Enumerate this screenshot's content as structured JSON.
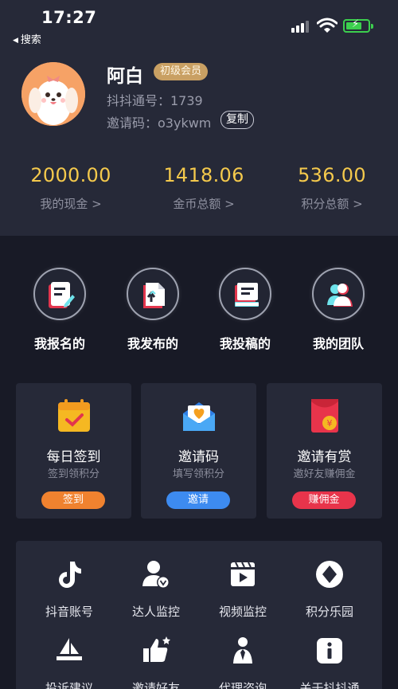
{
  "status_bar": {
    "time": "17:27",
    "back_label": "搜索"
  },
  "profile": {
    "name": "阿白",
    "badge": "初级会员",
    "uid_text": "抖抖通号：1739",
    "invite_text": "邀请码：o3ykwm",
    "copy_label": "复制"
  },
  "stats": [
    {
      "value": "2000.00",
      "label": "我的现金 >"
    },
    {
      "value": "1418.06",
      "label": "金币总额 >"
    },
    {
      "value": "536.00",
      "label": "积分总额 >"
    }
  ],
  "quick_nav": [
    {
      "label": "我报名的",
      "icon": "edit-form-icon"
    },
    {
      "label": "我发布的",
      "icon": "publish-file-icon"
    },
    {
      "label": "我投稿的",
      "icon": "submit-document-icon"
    },
    {
      "label": "我的团队",
      "icon": "team-icon"
    }
  ],
  "cards": [
    {
      "title": "每日签到",
      "subtitle": "签到领积分",
      "button": "签到",
      "button_color": "#f0822f",
      "icon": "calendar-check-icon"
    },
    {
      "title": "邀请码",
      "subtitle": "填写领积分",
      "button": "邀请",
      "button_color": "#3d8bf0",
      "icon": "envelope-heart-icon"
    },
    {
      "title": "邀请有赏",
      "subtitle": "邀好友赚佣金",
      "button": "赚佣金",
      "button_color": "#e8344b",
      "icon": "red-envelope-icon"
    }
  ],
  "services": [
    {
      "label": "抖音账号",
      "icon": "tiktok-icon"
    },
    {
      "label": "达人监控",
      "icon": "user-verified-icon"
    },
    {
      "label": "视频监控",
      "icon": "video-clapper-icon"
    },
    {
      "label": "积分乐园",
      "icon": "diamond-icon"
    },
    {
      "label": "投诉建议",
      "icon": "complaint-icon"
    },
    {
      "label": "邀请好友",
      "icon": "thumbs-up-icon"
    },
    {
      "label": "代理咨询",
      "icon": "agent-icon"
    },
    {
      "label": "关于抖抖通",
      "icon": "info-icon"
    }
  ],
  "colors": {
    "accent_gold": "#f4c94c",
    "background": "#181a26",
    "panel": "#262938"
  }
}
